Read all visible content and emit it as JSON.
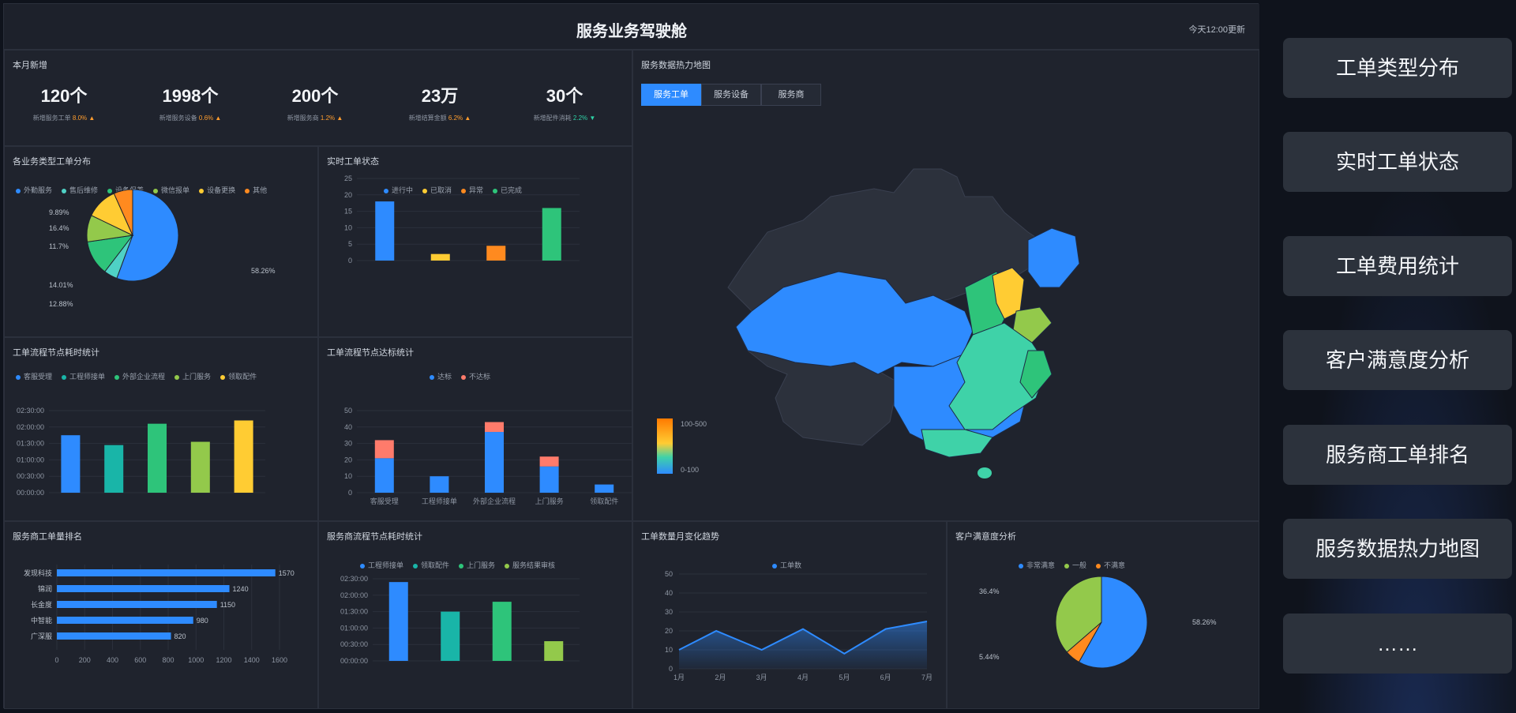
{
  "header": {
    "title": "服务业务驾驶舱",
    "update": "今天12:00更新"
  },
  "kpi": {
    "title": "本月新增",
    "items": [
      {
        "value": "120个",
        "label": "新增服务工单",
        "pct": "8.0%",
        "dir": "up"
      },
      {
        "value": "1998个",
        "label": "新增服务设备",
        "pct": "0.6%",
        "dir": "up"
      },
      {
        "value": "200个",
        "label": "新增服务商",
        "pct": "1.2%",
        "dir": "up"
      },
      {
        "value": "23万",
        "label": "新增结算金额",
        "pct": "6.2%",
        "dir": "up"
      },
      {
        "value": "30个",
        "label": "新增配件消耗",
        "pct": "2.2%",
        "dir": "down"
      }
    ]
  },
  "map": {
    "title": "服务数据热力地图",
    "tabs": [
      "服务工单",
      "服务设备",
      "服务商"
    ],
    "active_tab": 0,
    "scale_high": "100-500",
    "scale_low": "0-100"
  },
  "pie1": {
    "title": "各业务类型工单分布"
  },
  "status": {
    "title": "实时工单状态"
  },
  "flow_time": {
    "title": "工单流程节点耗时统计"
  },
  "flow_sla": {
    "title": "工单流程节点达标统计"
  },
  "provider_rank": {
    "title": "服务商工单量排名"
  },
  "provider_flow": {
    "title": "服务商流程节点耗时统计"
  },
  "trend": {
    "title": "工单数量月变化趋势"
  },
  "satisfaction": {
    "title": "客户满意度分析"
  },
  "right_menu": [
    "工单类型分布",
    "实时工单状态",
    "工单费用统计",
    "客户满意度分析",
    "服务商工单排名",
    "服务数据热力地图",
    "……"
  ],
  "chart_data": [
    {
      "id": "pie1",
      "type": "pie",
      "series": [
        {
          "name": "外勤服务",
          "value": 58.26,
          "color": "#2e8bff"
        },
        {
          "name": "售后维修",
          "value": 5.0,
          "color": "#4fd1c5"
        },
        {
          "name": "设备保养",
          "value": 12.88,
          "color": "#2ec47a"
        },
        {
          "name": "微信报单",
          "value": 9.89,
          "color": "#93c94b"
        },
        {
          "name": "设备更换",
          "value": 11.7,
          "color": "#ffcc33"
        },
        {
          "name": "其他",
          "value": 7.0,
          "color": "#ff8a1f"
        }
      ],
      "labels": [
        "9.89%",
        "16.4%",
        "11.7%",
        "14.01%",
        "12.88%",
        "58.26%"
      ]
    },
    {
      "id": "status",
      "type": "bar",
      "categories": [
        "进行中",
        "已取消",
        "异常",
        "已完成"
      ],
      "values": [
        18,
        2,
        4.5,
        16
      ],
      "colors": [
        "#2e8bff",
        "#ffcc33",
        "#ff8a1f",
        "#2ec47a"
      ],
      "ylim": [
        0,
        25
      ],
      "yticks": [
        0,
        5,
        10,
        15,
        20,
        25
      ]
    },
    {
      "id": "flow_time",
      "type": "bar",
      "categories": [
        "客服受理",
        "工程师接单",
        "外部企业流程",
        "上门服务",
        "领取配件"
      ],
      "values": [
        1.75,
        1.45,
        2.1,
        1.55,
        2.2
      ],
      "colors": [
        "#2e8bff",
        "#19b5a8",
        "#2ec47a",
        "#93c94b",
        "#ffcc33"
      ],
      "yticks": [
        "00:00:00",
        "00:30:00",
        "01:00:00",
        "01:30:00",
        "02:00:00",
        "02:30:00"
      ],
      "ylim": [
        0,
        2.5
      ]
    },
    {
      "id": "flow_sla",
      "type": "bar",
      "stacked": true,
      "legend": [
        "达标",
        "不达标"
      ],
      "categories": [
        "客服受理",
        "工程师接单",
        "外部企业流程",
        "上门服务",
        "领取配件"
      ],
      "series": [
        {
          "name": "达标",
          "values": [
            21,
            10,
            37,
            16,
            5
          ],
          "color": "#2e8bff"
        },
        {
          "name": "不达标",
          "values": [
            11,
            0,
            6,
            6,
            0
          ],
          "color": "#ff7b6b"
        }
      ],
      "ylim": [
        0,
        50
      ],
      "yticks": [
        0,
        10,
        20,
        30,
        40,
        50
      ]
    },
    {
      "id": "provider_rank",
      "type": "bar",
      "orientation": "horizontal",
      "categories": [
        "发现科技",
        "锦润",
        "长金度",
        "中智能",
        "广深服"
      ],
      "values": [
        1570,
        1240,
        1150,
        980,
        820
      ],
      "xticks": [
        0,
        200,
        400,
        600,
        800,
        1000,
        1200,
        1400,
        1600
      ],
      "xlim": [
        0,
        1600
      ]
    },
    {
      "id": "provider_flow",
      "type": "bar",
      "categories": [
        "工程师接单",
        "领取配件",
        "上门服务",
        "服务结果审核"
      ],
      "values": [
        2.4,
        1.5,
        1.8,
        0.6
      ],
      "colors": [
        "#2e8bff",
        "#19b5a8",
        "#2ec47a",
        "#93c94b"
      ],
      "yticks": [
        "00:00:00",
        "00:30:00",
        "01:00:00",
        "01:30:00",
        "02:00:00",
        "02:30:00"
      ],
      "ylim": [
        0,
        2.5
      ]
    },
    {
      "id": "trend",
      "type": "area",
      "legend": [
        "工单数"
      ],
      "x": [
        "1月",
        "2月",
        "3月",
        "4月",
        "5月",
        "6月",
        "7月"
      ],
      "values": [
        10,
        20,
        10,
        21,
        8,
        21,
        25
      ],
      "xpts": [
        0,
        0.9,
        2,
        3,
        4,
        5,
        6
      ],
      "ylim": [
        0,
        50
      ],
      "yticks": [
        0,
        10,
        20,
        30,
        40,
        50
      ]
    },
    {
      "id": "satisfaction",
      "type": "pie",
      "legend": [
        "非常满意",
        "一般",
        "不满意"
      ],
      "series": [
        {
          "name": "非常满意",
          "value": 58.26,
          "color": "#2e8bff"
        },
        {
          "name": "不满意",
          "value": 5.44,
          "color": "#ff8a1f"
        },
        {
          "name": "一般",
          "value": 36.4,
          "color": "#93c94b"
        }
      ],
      "labels": [
        "36.4%",
        "5.44%",
        "58.26%"
      ]
    }
  ]
}
